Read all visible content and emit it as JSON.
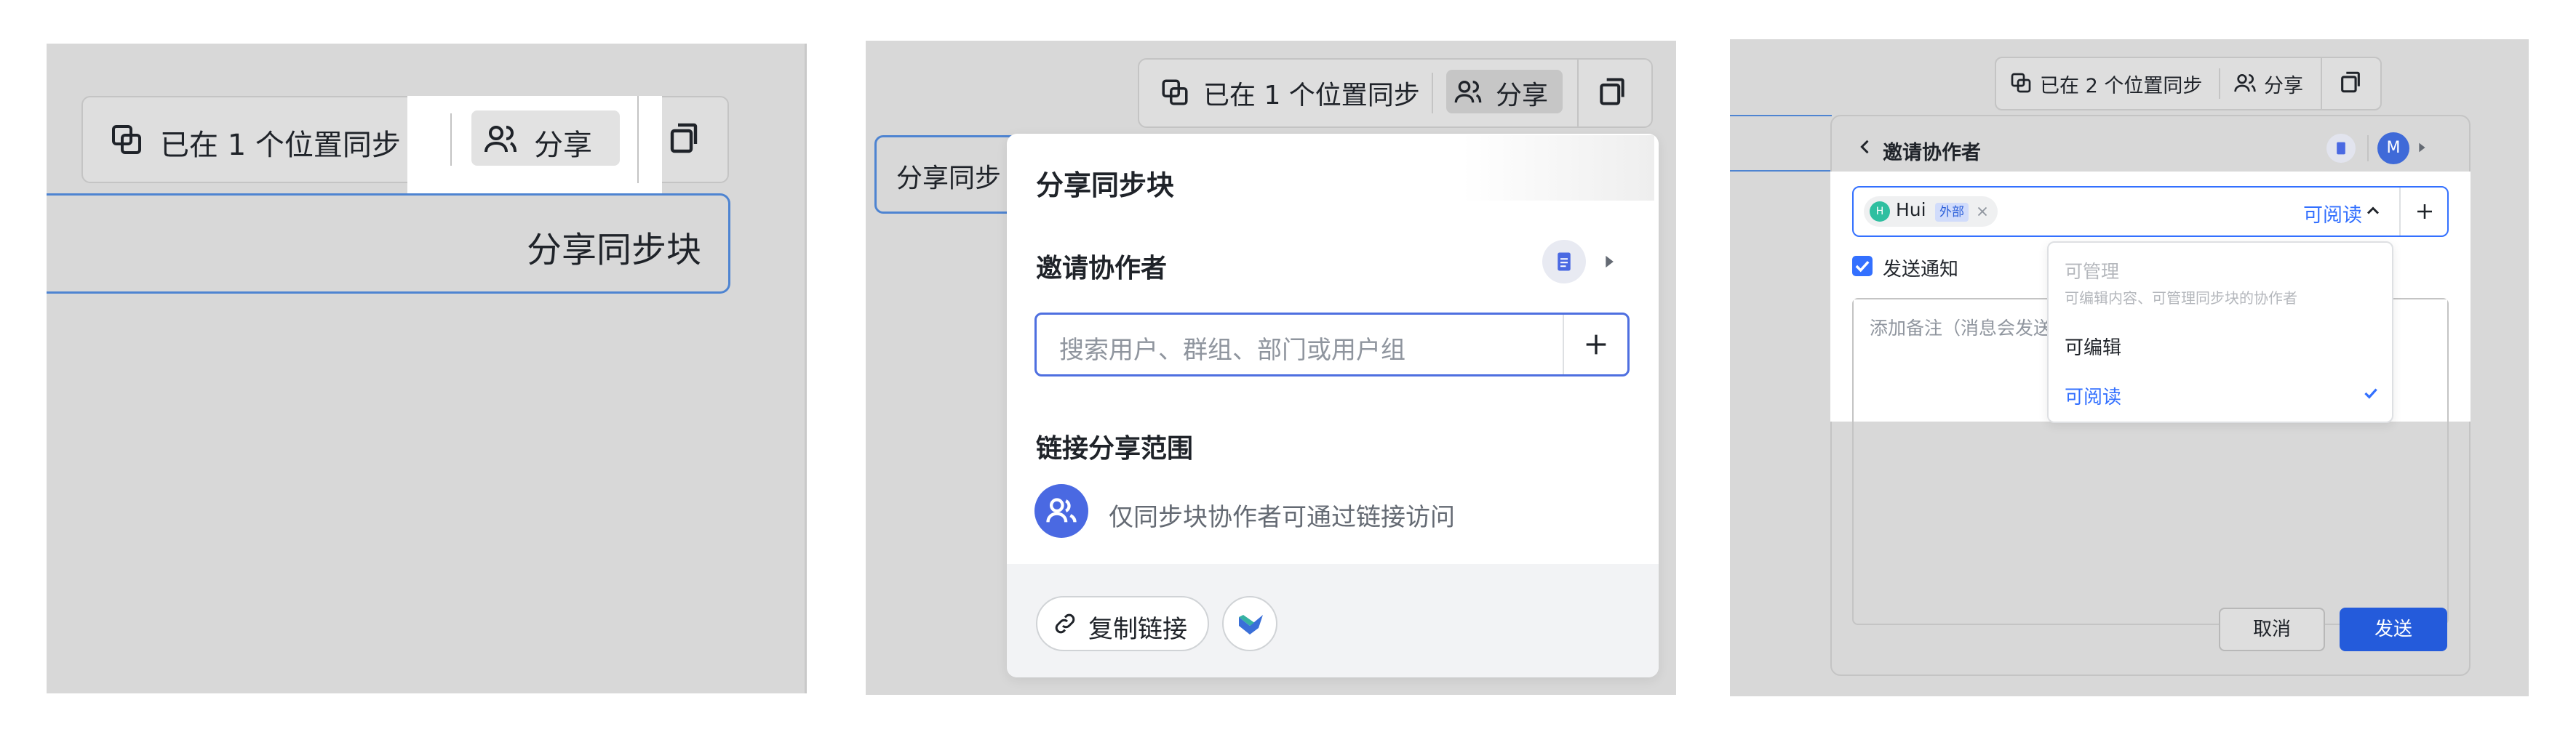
{
  "panel1": {
    "toolbar": {
      "sync_label": "已在 1 个位置同步",
      "share_label": "分享"
    },
    "block_label": "分享同步块"
  },
  "panel2": {
    "toolbar": {
      "sync_label": "已在 1 个位置同步",
      "share_label": "分享"
    },
    "block_label": "分享同步",
    "popup": {
      "title": "分享同步块",
      "invite_title": "邀请协作者",
      "search_placeholder": "搜索用户、群组、部门或用户组",
      "scope_title": "链接分享范围",
      "scope_desc": "仅同步块协作者可通过链接访问",
      "copy_link_label": "复制链接"
    }
  },
  "panel3": {
    "toolbar": {
      "sync_label": "已在 2 个位置同步",
      "share_label": "分享"
    },
    "dialog": {
      "title": "邀请协作者",
      "avatar_initial": "M",
      "chip_initial": "H",
      "chip_name": "Hui",
      "chip_tag": "外部",
      "permission_label": "可阅读",
      "notify_label": "发送通知",
      "note_placeholder": "添加备注（消息会发送",
      "cancel_label": "取消",
      "send_label": "发送"
    },
    "dropdown": {
      "options": [
        {
          "label": "可管理",
          "desc": "可编辑内容、可管理同步块的协作者"
        },
        {
          "label": "可编辑"
        },
        {
          "label": "可阅读"
        }
      ]
    }
  },
  "colors": {
    "accent": "#3370ff",
    "send_button": "#245bdb",
    "chip_avatar": "#2fbfa0",
    "panel_bg": "#d8d8d8"
  }
}
